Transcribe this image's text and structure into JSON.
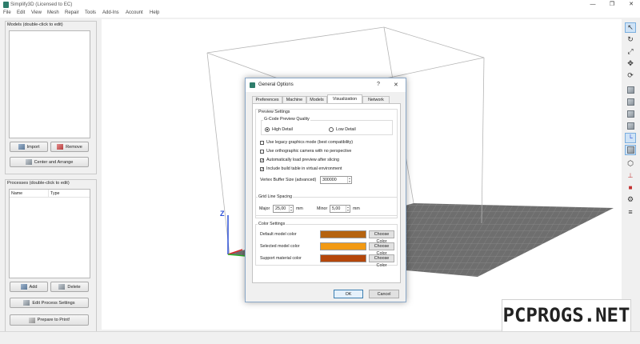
{
  "window": {
    "title": "Simplify3D (Licensed to EC)",
    "min": "—",
    "max": "❐",
    "close": "✕"
  },
  "menu": [
    "File",
    "Edit",
    "View",
    "Mesh",
    "Repair",
    "Tools",
    "Add-Ins",
    "Account",
    "Help"
  ],
  "models_panel": {
    "label": "Models (double-click to edit)",
    "import": "Import",
    "remove": "Remove",
    "center": "Center and Arrange"
  },
  "processes_panel": {
    "label": "Processes (double-click to edit)",
    "col_name": "Name",
    "col_type": "Type",
    "add": "Add",
    "delete": "Delete",
    "edit": "Edit Process Settings",
    "prepare": "Prepare to Print!"
  },
  "viewport": {
    "axis_z": "Z"
  },
  "dialog": {
    "title": "General Options",
    "help": "?",
    "close": "✕",
    "tabs": [
      "Preferences",
      "Machine",
      "Models",
      "Visualization",
      "Network"
    ],
    "active_tab": "Visualization",
    "preview": {
      "label": "Preview Settings",
      "gcode_label": "G-Code Preview Quality",
      "high": "High Detail",
      "low": "Low Detail",
      "selected": "High Detail",
      "options": [
        {
          "label": "Use legacy graphics mode (best compatibility)",
          "checked": false
        },
        {
          "label": "Use orthographic camera with no perspective",
          "checked": false
        },
        {
          "label": "Automatically load preview after slicing",
          "checked": true
        },
        {
          "label": "Include build table in virtual environment",
          "checked": true
        }
      ],
      "vbuffer_label": "Vertex Buffer Size (advanced)",
      "vbuffer_value": "300000"
    },
    "grid": {
      "label": "Grid Line Spacing",
      "major_label": "Major",
      "major_value": "25,00",
      "minor_label": "Minor",
      "minor_value": "5,00",
      "unit": "mm"
    },
    "colors": {
      "label": "Color Settings",
      "items": [
        {
          "label": "Default model color",
          "color": "#b5630f",
          "button": "Choose Color"
        },
        {
          "label": "Selected model color",
          "color": "#f29a13",
          "button": "Choose Color"
        },
        {
          "label": "Support material color",
          "color": "#b5470b",
          "button": "Choose Color"
        }
      ]
    },
    "ok": "OK",
    "cancel": "Cancel"
  },
  "watermark": "PCPROGS.NET",
  "icons": {
    "app": "simplify3d-logo-icon",
    "toolbar": [
      "pointer-icon",
      "rotate-view-icon",
      "scale-view-icon",
      "pan-icon",
      "refresh-icon",
      "view-iso-icon",
      "view-front-icon",
      "view-top-icon",
      "view-bottom-icon",
      "view-left-icon",
      "axis-toggle-icon",
      "cube-selected-icon",
      "mesh-icon",
      "cross-section-icon",
      "build-table-icon",
      "settings-gear-icon",
      "layers-icon"
    ]
  }
}
